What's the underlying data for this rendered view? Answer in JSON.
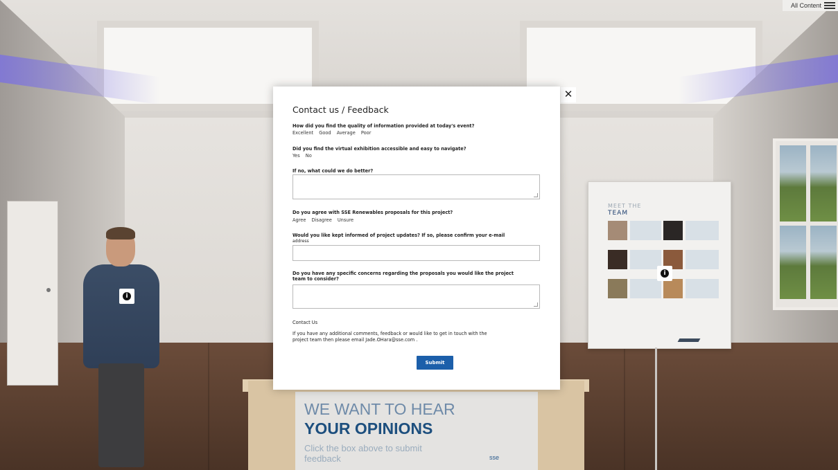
{
  "menu": {
    "label": "All Content"
  },
  "modal": {
    "title": "Contact us / Feedback",
    "close_glyph": "✕",
    "q1": {
      "label": "How did you find the quality of information provided at today's event?",
      "options": [
        "Excellent",
        "Good",
        "Average",
        "Poor"
      ]
    },
    "q2": {
      "label": "Did you find the virtual exhibition accessible and easy to navigate?",
      "options": [
        "Yes",
        "No"
      ]
    },
    "q3": {
      "label": "If no, what could we do better?",
      "value": ""
    },
    "q4": {
      "label": "Do you agree with SSE Renewables proposals for this project?",
      "options": [
        "Agree",
        "Disagree",
        "Unsure"
      ]
    },
    "q5": {
      "label_line1": "Would you like kept informed of project updates? If so, please confirm your e-mail",
      "label_line2": "address",
      "value": ""
    },
    "q6": {
      "label_line1": "Do you have any specific concerns regarding the proposals you would like the project",
      "label_line2": "team to consider?",
      "value": ""
    },
    "contact_heading": "Contact Us",
    "contact_text_line1": "If you have any additional comments, feedback or would like to get in touch with the",
    "contact_text_line2": "project team then please email Jade.OHara@sse.com .",
    "submit_label": "Submit"
  },
  "scene": {
    "table_panel": {
      "line1": "WE WANT TO HEAR",
      "line2": "YOUR OPINIONS",
      "line3": "Click the box above to submit feedback",
      "logo": "sse"
    },
    "team_board": {
      "title_top": "MEET THE",
      "title": "TEAM"
    }
  },
  "colors": {
    "submit_bg": "#1c5faa",
    "panel_heading": "#1d4f7e"
  }
}
